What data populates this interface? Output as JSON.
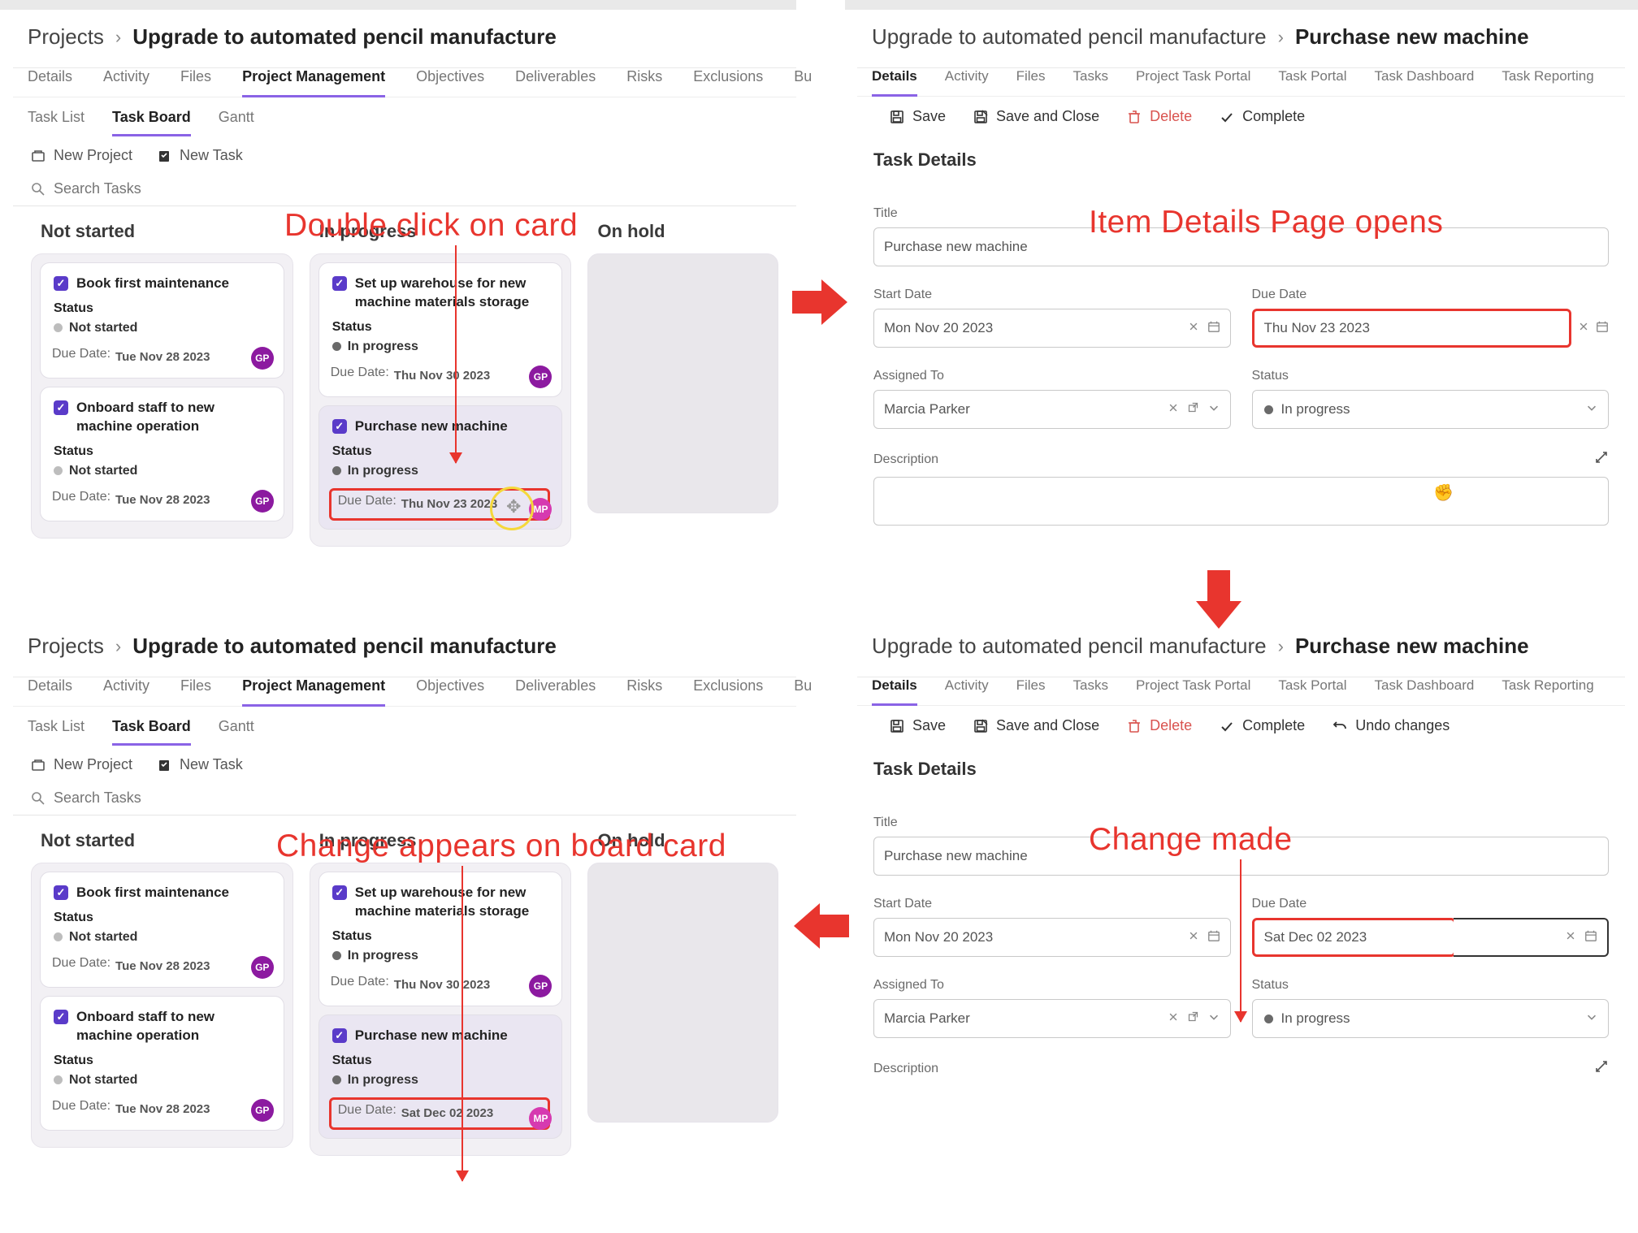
{
  "breadcrumb": {
    "root": "Projects",
    "project": "Upgrade to automated pencil manufacture",
    "task": "Purchase new machine"
  },
  "tabs1": [
    "Details",
    "Activity",
    "Files",
    "Project Management",
    "Objectives",
    "Deliverables",
    "Risks",
    "Exclusions",
    "Bu"
  ],
  "subtabs": [
    "Task List",
    "Task Board",
    "Gantt"
  ],
  "toolbar": {
    "newProject": "New Project",
    "newTask": "New Task",
    "searchPH": "Search Tasks"
  },
  "columns": [
    "Not started",
    "In progress",
    "On hold"
  ],
  "cards": {
    "c1": {
      "title": "Book first maintenance",
      "statusLabel": "Status",
      "status": "Not started",
      "dueLbl": "Due Date:",
      "due": "Tue Nov 28 2023",
      "avatar": "GP"
    },
    "c2": {
      "title": "Onboard staff to new machine operation",
      "statusLabel": "Status",
      "status": "Not started",
      "dueLbl": "Due Date:",
      "due": "Tue Nov 28 2023",
      "avatar": "GP"
    },
    "c3": {
      "title": "Set up warehouse for new machine materials storage",
      "statusLabel": "Status",
      "status": "In progress",
      "dueLbl": "Due Date:",
      "due": "Thu Nov 30 2023",
      "avatar": "GP"
    },
    "c4": {
      "title": "Purchase new machine",
      "statusLabel": "Status",
      "status": "In progress",
      "dueLbl": "Due Date:",
      "due": "Thu Nov 23 2023",
      "avatar": "MP"
    },
    "c4b": {
      "title": "Purchase new machine",
      "statusLabel": "Status",
      "status": "In progress",
      "dueLbl": "Due Date:",
      "due": "Sat Dec 02 2023",
      "avatar": "MP"
    }
  },
  "detailTabs": [
    "Details",
    "Activity",
    "Files",
    "Tasks",
    "Project Task Portal",
    "Task Portal",
    "Task Dashboard",
    "Task Reporting"
  ],
  "detailActions": {
    "save": "Save",
    "saveClose": "Save and Close",
    "delete": "Delete",
    "complete": "Complete",
    "undo": "Undo changes"
  },
  "section": "Task Details",
  "form": {
    "titleLbl": "Title",
    "title": "Purchase new machine",
    "startLbl": "Start Date",
    "start": "Mon Nov 20 2023",
    "dueLbl": "Due Date",
    "due1": "Thu Nov 23 2023",
    "due2": "Sat Dec 02 2023",
    "assignLbl": "Assigned To",
    "assign": "Marcia Parker",
    "statusLbl": "Status",
    "status": "In progress",
    "descLbl": "Description"
  },
  "callouts": {
    "topLeft": "Double click on card",
    "topRight": "Item Details Page opens",
    "botLeft": "Change appears on board card",
    "botRight": "Change made"
  }
}
